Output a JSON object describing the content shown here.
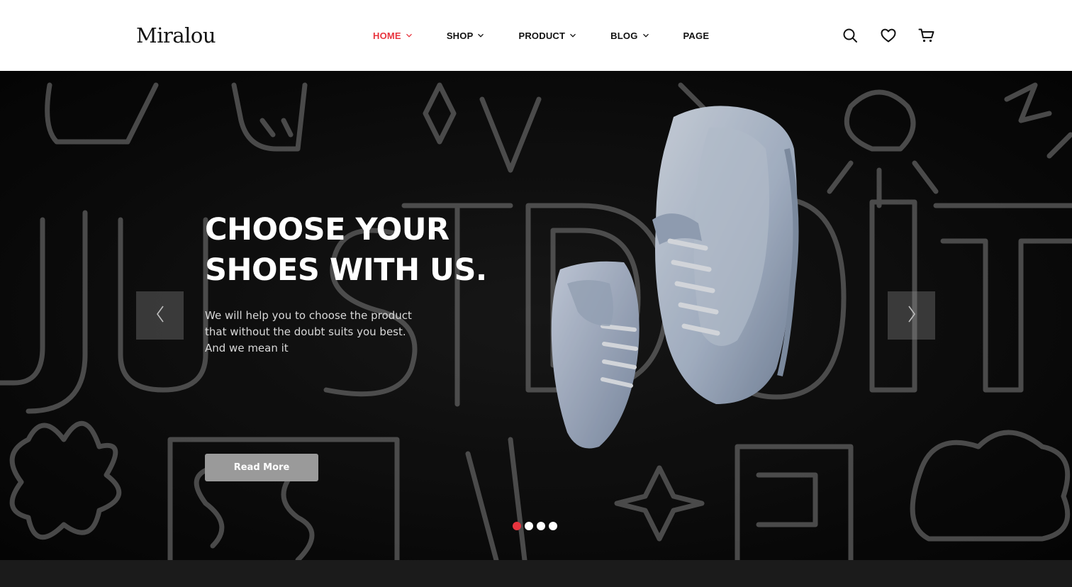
{
  "header": {
    "logo": "Miralou",
    "nav": [
      {
        "label": "HOME",
        "dropdown": true,
        "active": true
      },
      {
        "label": "SHOP",
        "dropdown": true,
        "active": false
      },
      {
        "label": "PRODUCT",
        "dropdown": true,
        "active": false
      },
      {
        "label": "BLOG",
        "dropdown": true,
        "active": false
      },
      {
        "label": "PAGE",
        "dropdown": false,
        "active": false
      }
    ],
    "icons": [
      "search-icon",
      "heart-icon",
      "cart-icon"
    ]
  },
  "hero": {
    "title_line1": "CHOOSE YOUR",
    "title_line2": "SHOES WITH US.",
    "desc_line1": "We will help you to choose the product",
    "desc_line2": "that without the doubt suits you best.",
    "desc_line3": "And we mean it",
    "cta_label": "Read More",
    "slides_total": 4,
    "active_slide": 1,
    "prev_icon": "chevron-left-icon",
    "next_icon": "chevron-right-icon"
  },
  "colors": {
    "accent": "#e8343e",
    "header_bg": "#ffffff",
    "hero_bg": "#0d0d0d",
    "button_bg": "#9a9a9a",
    "footer_bg": "#1b1b1b"
  }
}
